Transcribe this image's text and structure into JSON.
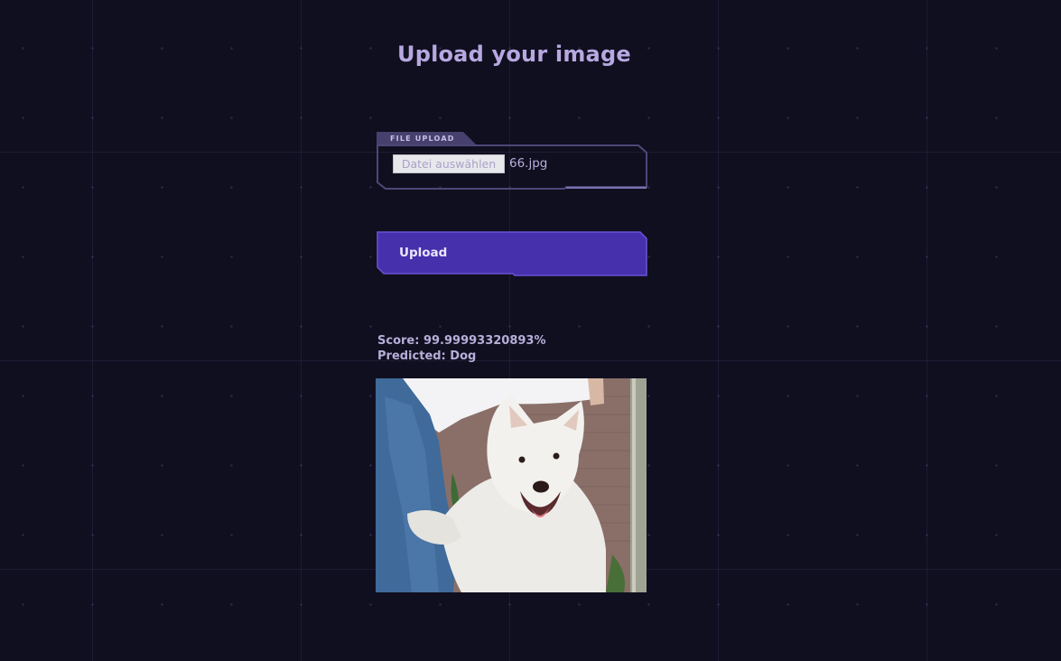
{
  "page": {
    "title": "Upload your image"
  },
  "file_upload": {
    "tab_label": "FILE UPLOAD",
    "choose_button_label": "Datei auswählen",
    "selected_file_name": "66.jpg"
  },
  "upload_button": {
    "label": "Upload"
  },
  "result": {
    "score_text": "Score: 99.99993320893%",
    "predicted_text": "Predicted: Dog"
  },
  "preview_image": {
    "subject": "white dog",
    "icon": "dog-photo"
  },
  "colors": {
    "background": "#100f1f",
    "accent": "#4630ab",
    "accent_border": "#6a52d8",
    "text_primary": "#b7a8e0",
    "frame": "#4d4778"
  }
}
